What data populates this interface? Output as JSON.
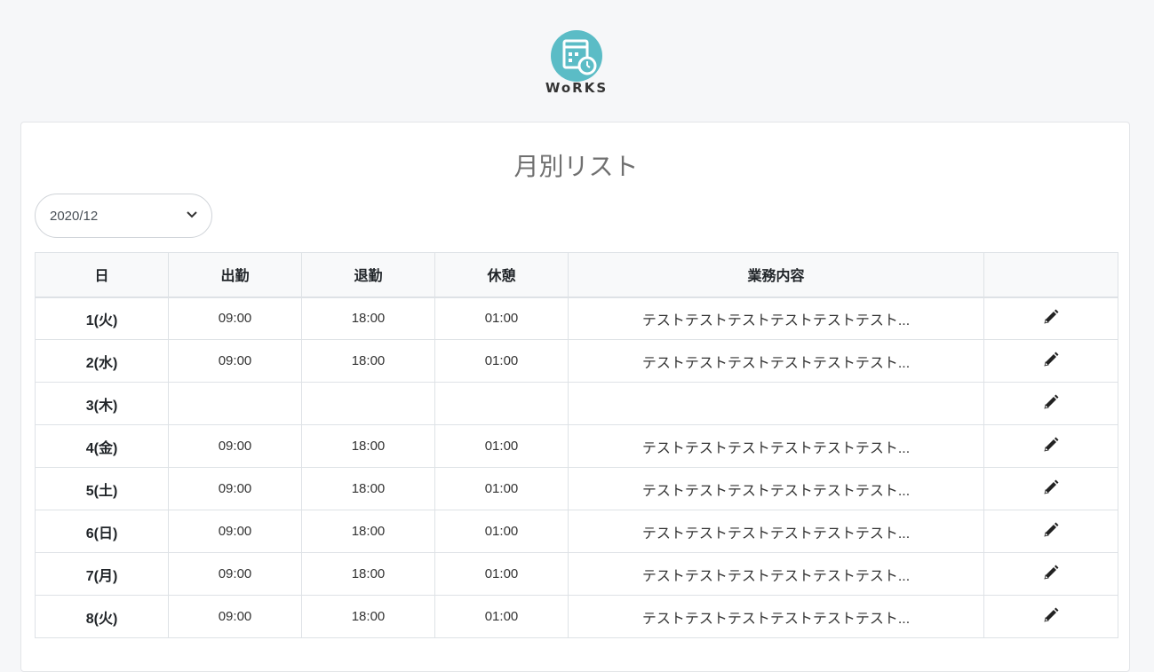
{
  "brand": {
    "logo_text": "WoRKS",
    "accent_color": "#5bbcc6"
  },
  "page": {
    "title": "月別リスト"
  },
  "month_select": {
    "value": "2020/12"
  },
  "table": {
    "headers": [
      "日",
      "出勤",
      "退勤",
      "休憩",
      "業務内容",
      ""
    ],
    "rows": [
      {
        "day": "1(火)",
        "start": "09:00",
        "end": "18:00",
        "break": "01:00",
        "work": "テストテストテストテストテストテスト..."
      },
      {
        "day": "2(水)",
        "start": "09:00",
        "end": "18:00",
        "break": "01:00",
        "work": "テストテストテストテストテストテスト..."
      },
      {
        "day": "3(木)",
        "start": "",
        "end": "",
        "break": "",
        "work": ""
      },
      {
        "day": "4(金)",
        "start": "09:00",
        "end": "18:00",
        "break": "01:00",
        "work": "テストテストテストテストテストテスト..."
      },
      {
        "day": "5(土)",
        "start": "09:00",
        "end": "18:00",
        "break": "01:00",
        "work": "テストテストテストテストテストテスト..."
      },
      {
        "day": "6(日)",
        "start": "09:00",
        "end": "18:00",
        "break": "01:00",
        "work": "テストテストテストテストテストテスト..."
      },
      {
        "day": "7(月)",
        "start": "09:00",
        "end": "18:00",
        "break": "01:00",
        "work": "テストテストテストテストテストテスト..."
      },
      {
        "day": "8(火)",
        "start": "09:00",
        "end": "18:00",
        "break": "01:00",
        "work": "テストテストテストテストテストテスト..."
      }
    ],
    "edit_icon": "pencil-icon"
  }
}
